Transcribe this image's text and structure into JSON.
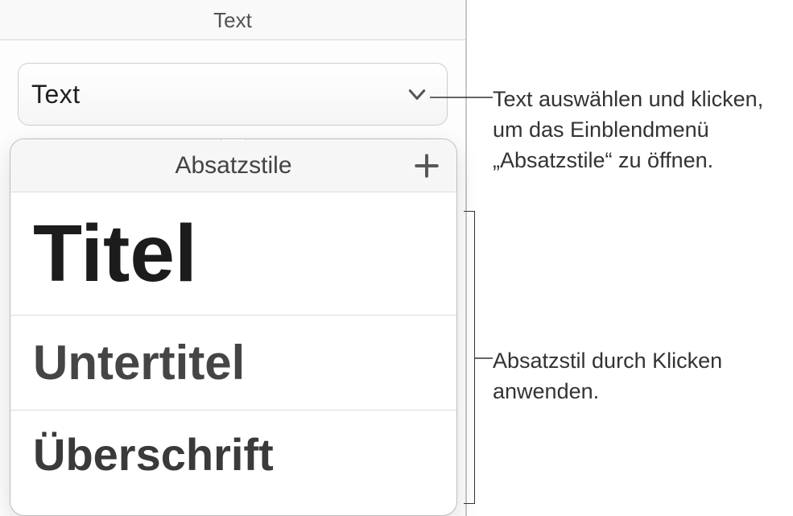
{
  "header": {
    "title": "Text"
  },
  "selector": {
    "current_style": "Text"
  },
  "popover": {
    "title": "Absatzstile",
    "styles": {
      "item0": "Titel",
      "item1": "Untertitel",
      "item2": "Überschrift"
    }
  },
  "callouts": {
    "c1": "Text auswählen und klicken, um das Einblendmenü „Absatzstile“ zu öffnen.",
    "c2": "Absatzstil durch Klicken anwenden."
  }
}
